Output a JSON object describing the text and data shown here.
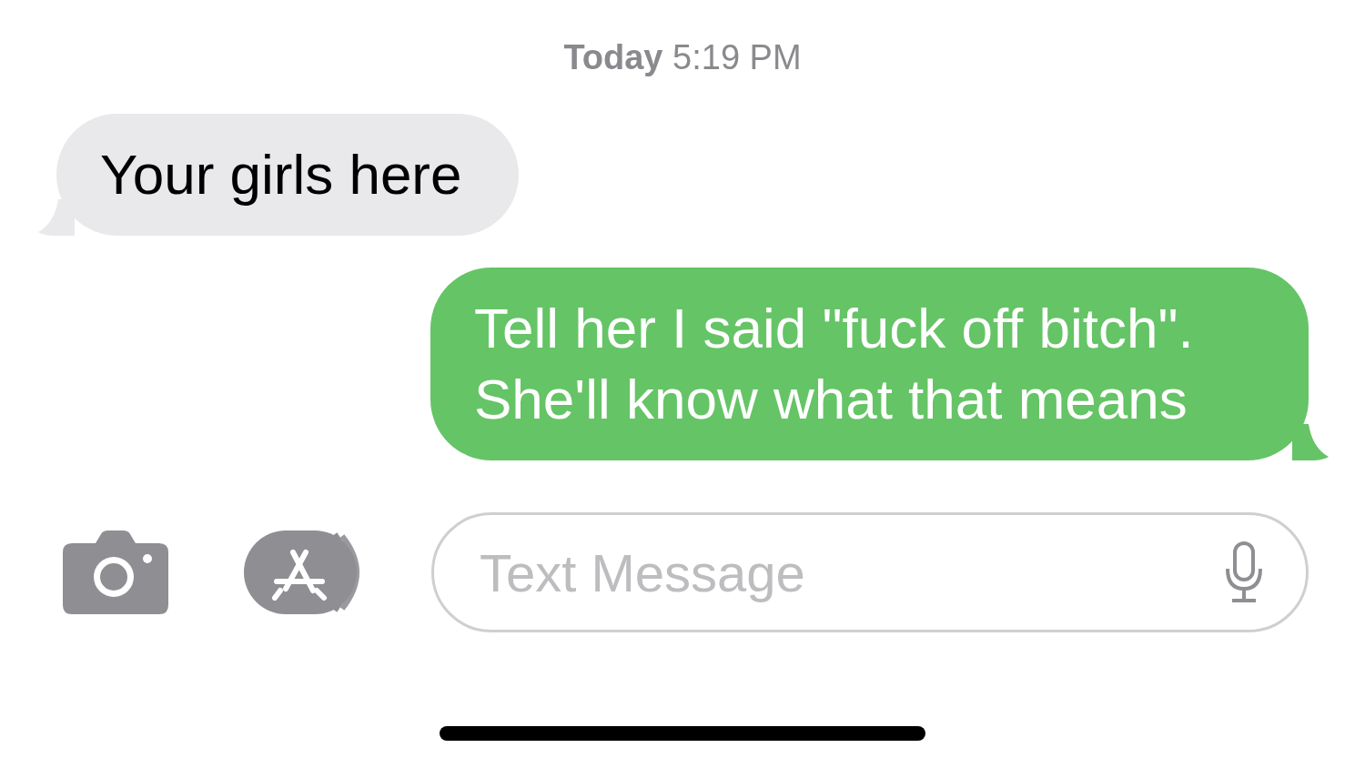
{
  "timestamp": {
    "day": "Today",
    "time": "5:19 PM"
  },
  "messages": [
    {
      "kind": "received",
      "text": "Your girls here"
    },
    {
      "kind": "sent",
      "text": "Tell her I said \"fuck off bitch\". She'll know what that means"
    }
  ],
  "compose": {
    "placeholder": "Text Message"
  }
}
